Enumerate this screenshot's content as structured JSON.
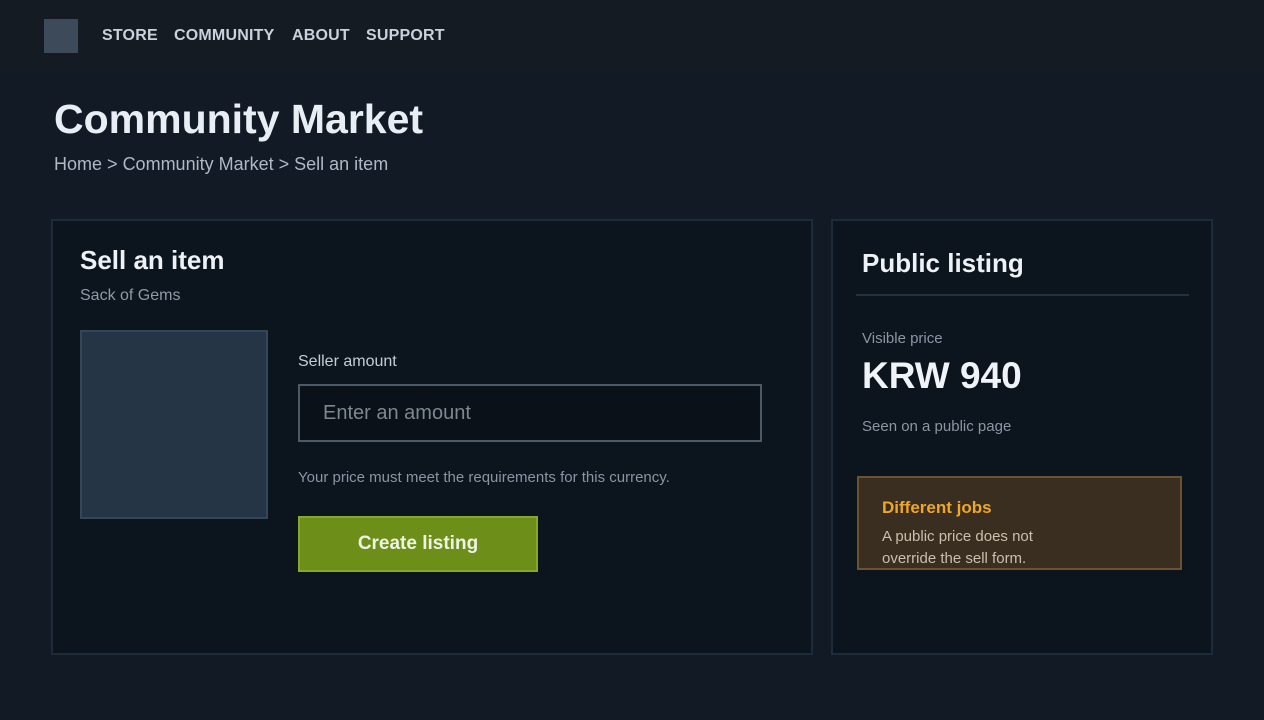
{
  "nav": {
    "logo_icon": "square-logo-icon",
    "links": [
      "STORE",
      "COMMUNITY",
      "ABOUT",
      "SUPPORT"
    ]
  },
  "header": {
    "title": "Community Market",
    "breadcrumb": [
      "Home",
      "Community Market",
      "Sell an item"
    ],
    "separator": ">"
  },
  "sell": {
    "title": "Sell an item",
    "item_name": "Sack of Gems",
    "amount_label": "Seller amount",
    "amount_value": "",
    "amount_placeholder": "Enter an amount",
    "hint": "Your price must meet the requirements for this currency.",
    "button_label": "Create listing"
  },
  "listing": {
    "title": "Public listing",
    "visible_label": "Visible price",
    "visible_price": "KRW 940",
    "seen_note": "Seen on a public page",
    "notice_title": "Different jobs",
    "notice_body": "A public price does not override the sell form."
  },
  "colors": {
    "background": "#111a25",
    "panel": "#0c141d",
    "accent_button": "#6e8e1a",
    "notice_bg": "#3a2e20",
    "notice_title": "#f0a626"
  }
}
